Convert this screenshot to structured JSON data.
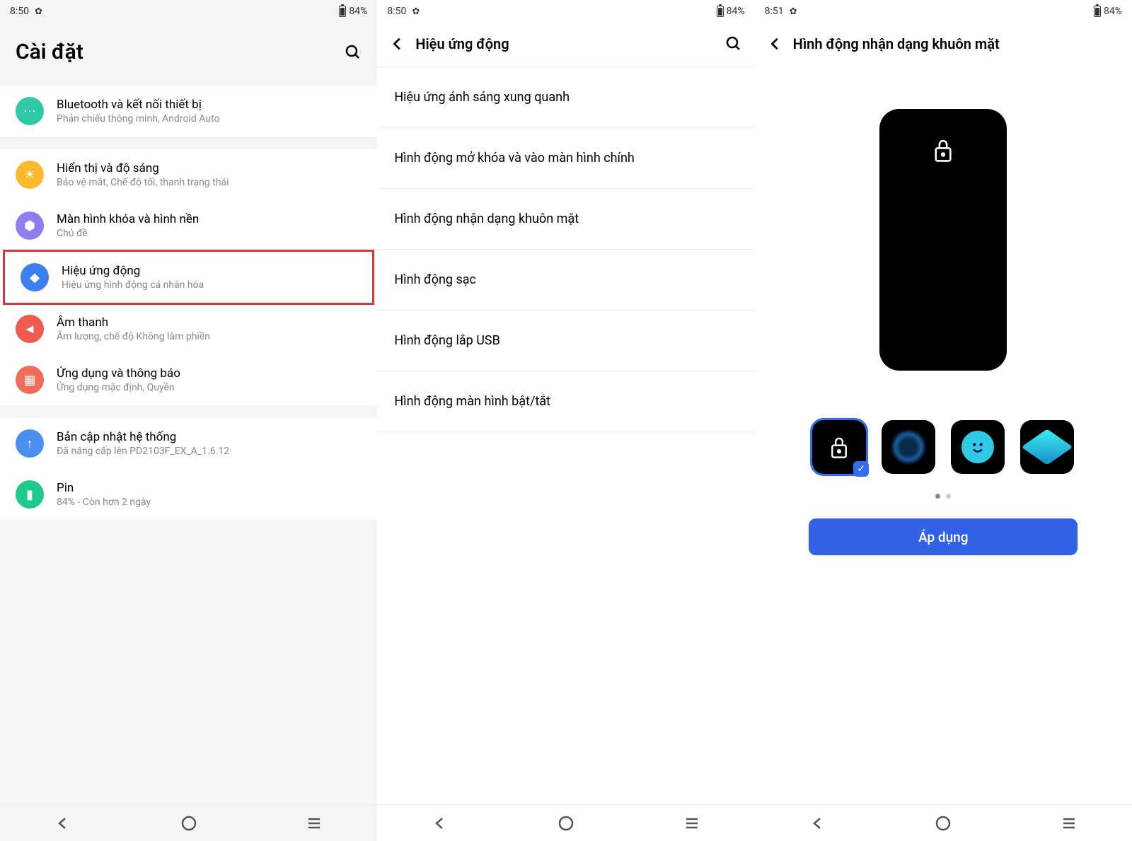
{
  "screen1": {
    "status": {
      "time": "8:50",
      "battery": "84%"
    },
    "title": "Cài đặt",
    "items": [
      {
        "title": "Bluetooth và kết nối thiết bị",
        "sub": "Phản chiếu thông minh, Android Auto",
        "icon": "ellipsis",
        "color": "teal"
      },
      {
        "title": "Hiển thị và độ sáng",
        "sub": "Bảo vệ mắt, Chế độ tối, thanh trạng thái",
        "icon": "sun",
        "color": "yellow"
      },
      {
        "title": "Màn hình khóa và hình nền",
        "sub": "Chủ đề",
        "icon": "brush",
        "color": "purple"
      },
      {
        "title": "Hiệu ứng động",
        "sub": "Hiệu ứng hình động cá nhân hóa",
        "icon": "layers",
        "color": "blue",
        "highlighted": true
      },
      {
        "title": "Âm thanh",
        "sub": "Âm lượng, chế độ Không làm phiền",
        "icon": "volume",
        "color": "red"
      },
      {
        "title": "Ứng dụng và thông báo",
        "sub": "Ứng dụng mặc định, Quyền",
        "icon": "apps",
        "color": "red2"
      },
      {
        "title": "Bản cập nhật hệ thống",
        "sub": "Đã nâng cấp lên PD2103F_EX_A_1.6.12",
        "icon": "update",
        "color": "blue2"
      },
      {
        "title": "Pin",
        "sub": "84% - Còn hơn 2 ngày",
        "icon": "battery",
        "color": "green"
      }
    ]
  },
  "screen2": {
    "status": {
      "time": "8:50",
      "battery": "84%"
    },
    "title": "Hiệu ứng động",
    "items": [
      "Hiệu ứng ánh sáng xung quanh",
      "Hình động mở khóa và vào màn hình chính",
      "Hình động nhận dạng khuôn mặt",
      "Hình động sạc",
      "Hình động lắp USB",
      "Hình động màn hình bật/tắt"
    ]
  },
  "screen3": {
    "status": {
      "time": "8:51",
      "battery": "84%"
    },
    "title": "Hình động nhận dạng khuôn mặt",
    "options": [
      "lock",
      "ring",
      "smiley",
      "cube"
    ],
    "selected_index": 0,
    "apply_label": "Áp dụng"
  }
}
